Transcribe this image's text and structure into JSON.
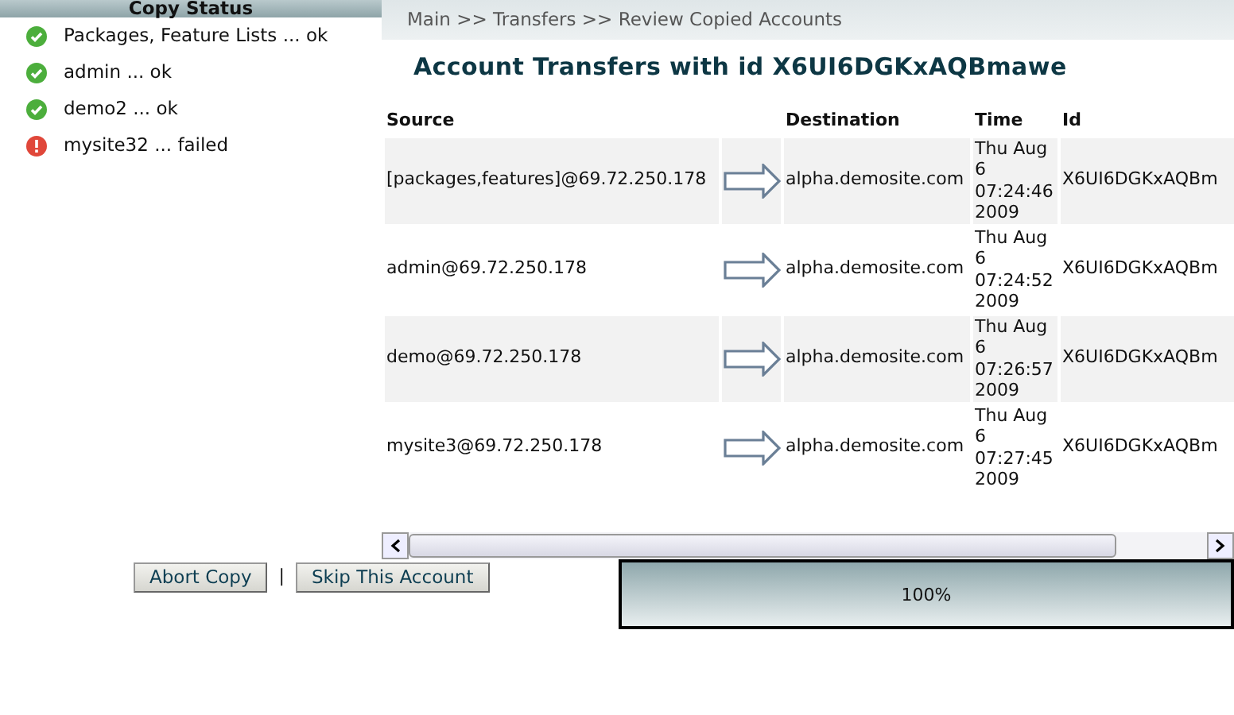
{
  "copy_status": {
    "title": "Copy Status",
    "items": [
      {
        "label": "Packages, Feature Lists ... ok",
        "kind": "success"
      },
      {
        "label": "admin ... ok",
        "kind": "success"
      },
      {
        "label": "demo2 ... ok",
        "kind": "success"
      },
      {
        "label": "mysite32 ... failed",
        "kind": "error"
      }
    ]
  },
  "breadcrumb": "Main >> Transfers >> Review Copied Accounts",
  "heading": "Account Transfers with id X6UI6DGKxAQBmawe",
  "table": {
    "columns": [
      "Source",
      "",
      "Destination",
      "Time",
      "Id"
    ],
    "rows": [
      {
        "source": "[packages,features]@69.72.250.178",
        "destination": "alpha.demosite.com",
        "time": [
          "Thu Aug",
          "6",
          "07:24:46",
          "2009"
        ],
        "id": "X6UI6DGKxAQBm"
      },
      {
        "source": "admin@69.72.250.178",
        "destination": "alpha.demosite.com",
        "time": [
          "Thu Aug",
          "6",
          "07:24:52",
          "2009"
        ],
        "id": "X6UI6DGKxAQBm"
      },
      {
        "source": "demo@69.72.250.178",
        "destination": "alpha.demosite.com",
        "time": [
          "Thu Aug",
          "6",
          "07:26:57",
          "2009"
        ],
        "id": "X6UI6DGKxAQBm"
      },
      {
        "source": "mysite3@69.72.250.178",
        "destination": "alpha.demosite.com",
        "time": [
          "Thu Aug",
          "6",
          "07:27:45",
          "2009"
        ],
        "id": "X6UI6DGKxAQBm"
      }
    ]
  },
  "buttons": [
    "Abort Copy",
    "Skip This Account"
  ],
  "separator": "|",
  "progress": {
    "level": 1,
    "reading": "100%"
  }
}
